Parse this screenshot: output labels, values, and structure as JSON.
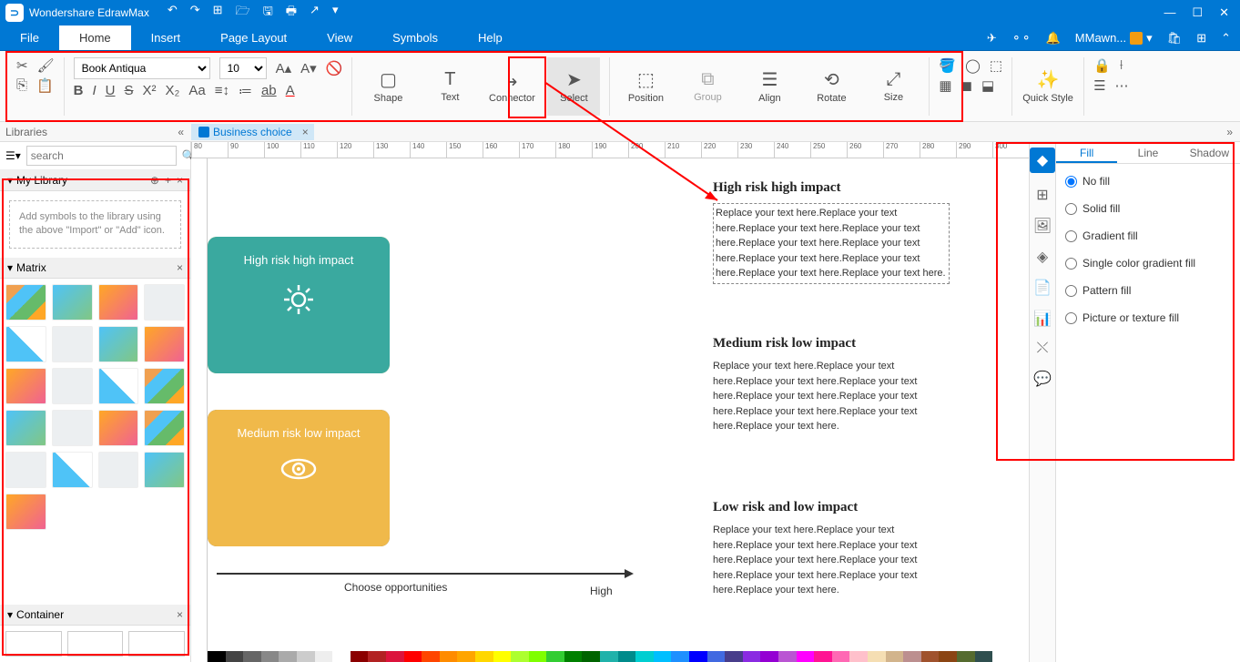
{
  "app": {
    "title": "Wondershare EdrawMax"
  },
  "menubar": {
    "tabs": [
      "File",
      "Home",
      "Insert",
      "Page Layout",
      "View",
      "Symbols",
      "Help"
    ],
    "user": "MMawn..."
  },
  "ribbon": {
    "font": "Book Antiqua",
    "size": "10",
    "shape": "Shape",
    "text": "Text",
    "connector": "Connector",
    "select": "Select",
    "position": "Position",
    "group": "Group",
    "align": "Align",
    "rotate": "Rotate",
    "size_btn": "Size",
    "quick_style": "Quick Style"
  },
  "doc": {
    "libraries": "Libraries",
    "tab_name": "Business choice"
  },
  "sidebar": {
    "search_placeholder": "search",
    "my_library": "My Library",
    "hint": "Add symbols to the library using the above \"Import\" or \"Add\" icon.",
    "matrix": "Matrix",
    "container": "Container"
  },
  "ruler_marks": [
    "80",
    "90",
    "100",
    "110",
    "120",
    "130",
    "140",
    "150",
    "160",
    "170",
    "180",
    "190",
    "200",
    "210",
    "220",
    "230",
    "240",
    "250",
    "260",
    "270",
    "280",
    "290",
    "300"
  ],
  "canvas": {
    "cards": {
      "tl": "Medium risk low impact",
      "tr": "High risk high impact",
      "bl": "Low risk and low impact",
      "br": "Medium risk low impact"
    },
    "axis": {
      "label": "Choose opportunities",
      "end": "High"
    },
    "sections": {
      "s1_title": "High risk high impact",
      "s1_body": "Replace your text here.Replace your text here.Replace your text here.Replace your text here.Replace your text here.Replace your text here.Replace your text here.Replace your text here.Replace your text here.Replace your text here.",
      "s2_title": "Medium risk low impact",
      "s2_body": "Replace your text here.Replace your text here.Replace your text here.Replace your text here.Replace your text here.Replace your text here.Replace your text here.Replace your text here.Replace your text here.",
      "s3_title": "Low risk and low impact",
      "s3_body": "Replace your text here.Replace your text here.Replace your text here.Replace your text here.Replace your text here.Replace your text here.Replace your text here.Replace your text here.Replace your text here."
    }
  },
  "right_panel": {
    "tabs": [
      "Fill",
      "Line",
      "Shadow"
    ],
    "options": [
      "No fill",
      "Solid fill",
      "Gradient fill",
      "Single color gradient fill",
      "Pattern fill",
      "Picture or texture fill"
    ]
  },
  "colors": [
    "#000",
    "#444",
    "#666",
    "#888",
    "#aaa",
    "#ccc",
    "#eee",
    "#fff",
    "#8b0000",
    "#b22222",
    "#dc143c",
    "#ff0000",
    "#ff4500",
    "#ff8c00",
    "#ffa500",
    "#ffd700",
    "#ffff00",
    "#adff2f",
    "#7fff00",
    "#32cd32",
    "#008000",
    "#006400",
    "#20b2aa",
    "#008b8b",
    "#00ced1",
    "#00bfff",
    "#1e90ff",
    "#0000ff",
    "#4169e1",
    "#483d8b",
    "#8a2be2",
    "#9400d3",
    "#ba55d3",
    "#ff00ff",
    "#ff1493",
    "#ff69b4",
    "#ffc0cb",
    "#f5deb3",
    "#d2b48c",
    "#bc8f8f",
    "#a0522d",
    "#8b4513",
    "#556b2f",
    "#2f4f4f"
  ]
}
